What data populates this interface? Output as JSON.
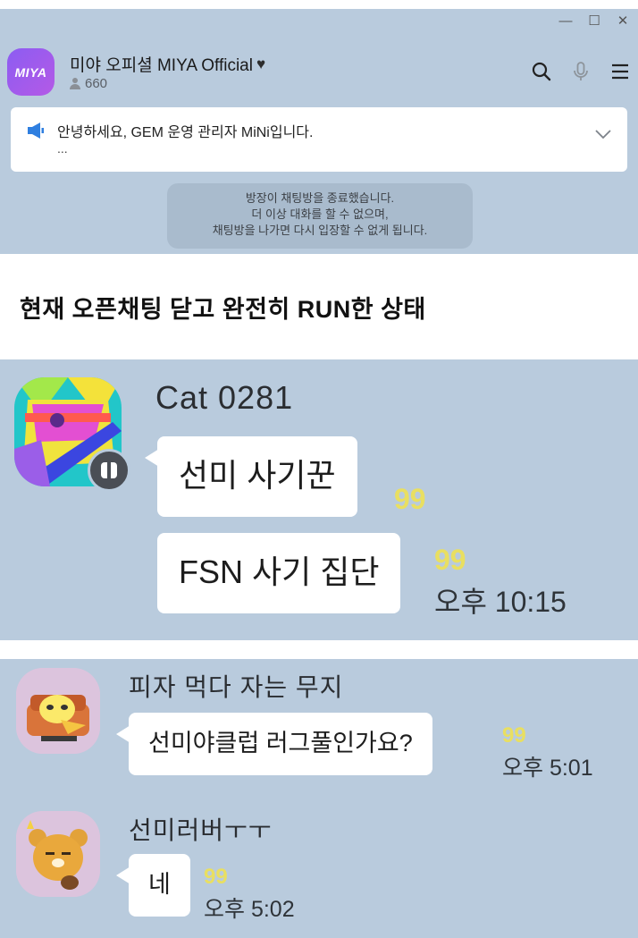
{
  "window": {
    "controls": {
      "minimize": "—",
      "maximize": "☐",
      "close": "✕"
    }
  },
  "room": {
    "logo_text": "MIYA",
    "title": "미야 오피셜 MIYA Official",
    "member_count": "660"
  },
  "notice": {
    "text": "안녕하세요, GEM 운영 관리자 MiNi입니다.",
    "more": "..."
  },
  "system_message": {
    "line1": "방장이 채팅방을 종료했습니다.",
    "line2": "더 이상 대화를 할 수 없으며,",
    "line3": "채팅방을 나가면 다시 입장할 수 없게 됩니다."
  },
  "caption": "현재 오픈채팅 닫고 완전히 RUN한 상태",
  "panel2": {
    "sender": "Cat 0281",
    "messages": [
      {
        "text": "선미 사기꾼",
        "unread": "99",
        "time": ""
      },
      {
        "text": "FSN 사기 집단",
        "unread": "99",
        "time": "오후 10:15"
      }
    ]
  },
  "panel3": {
    "conversations": [
      {
        "sender": "피자 먹다 자는 무지",
        "text": "선미야클럽  러그풀인가요?",
        "unread": "99",
        "time": "오후 5:01"
      },
      {
        "sender": "선미러버ㅜㅜ",
        "text": "네",
        "unread": "99",
        "time": "오후 5:02"
      }
    ]
  },
  "colors": {
    "chat_background": "#b9cbdd",
    "unread": "#e9df61",
    "logo": "#a05ae8"
  },
  "icons": [
    "search-icon",
    "mic-icon",
    "menu-icon",
    "speaker-icon",
    "chevron-down-icon",
    "person-icon",
    "heart-icon",
    "chat-badge-icon"
  ]
}
